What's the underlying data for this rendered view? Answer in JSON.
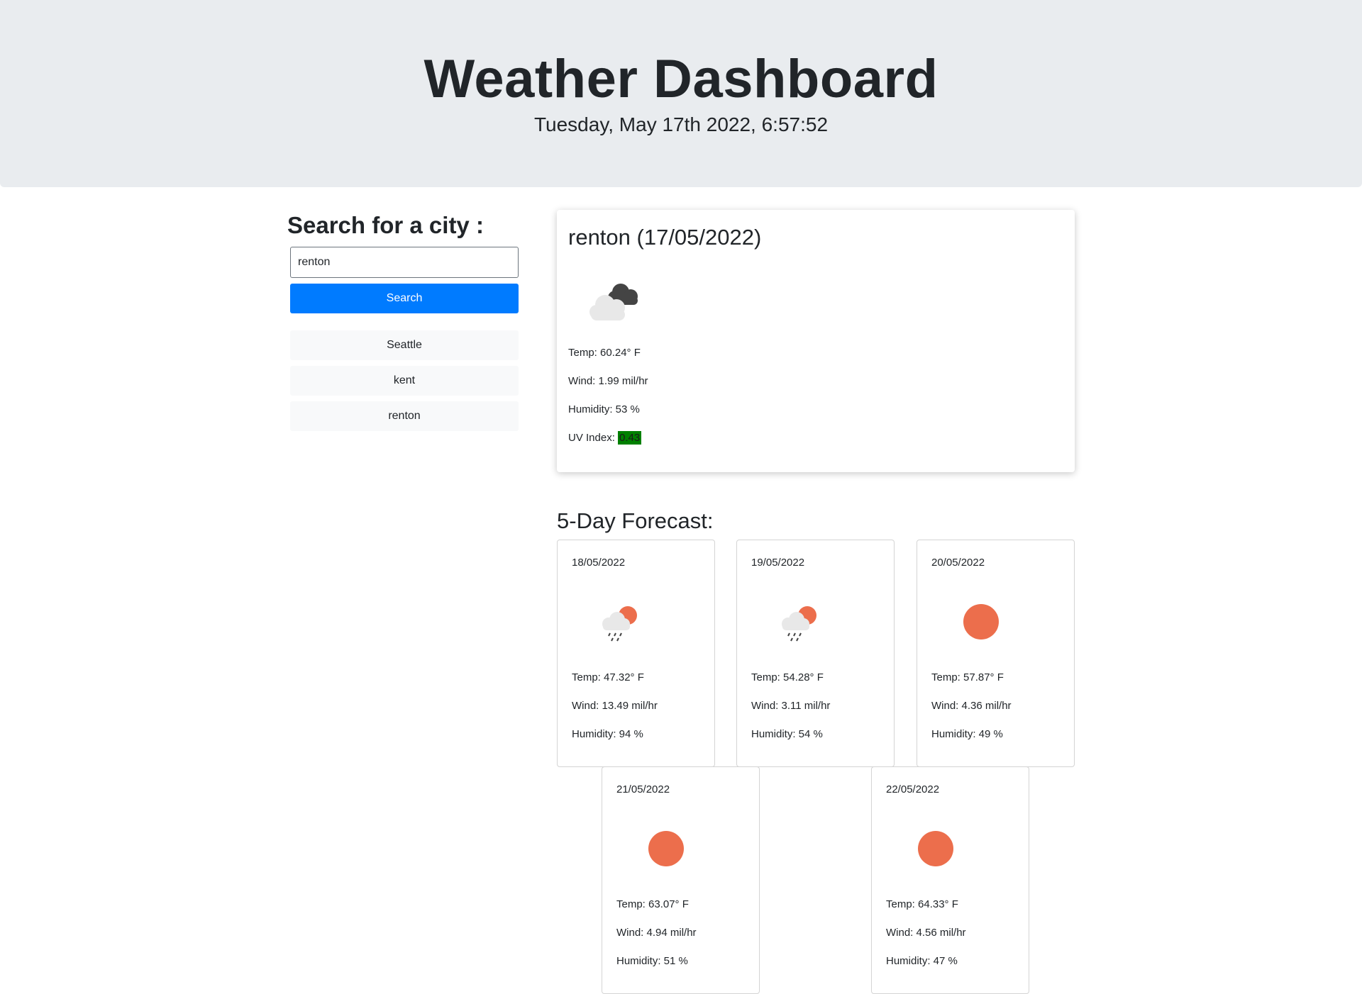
{
  "header": {
    "title": "Weather Dashboard",
    "datetime": "Tuesday, May 17th 2022, 6:57:52"
  },
  "search": {
    "heading": "Search for a city :",
    "value": "renton",
    "button_label": "Search",
    "history": [
      "Seattle",
      "kent",
      "renton"
    ]
  },
  "current": {
    "title": "renton (17/05/2022)",
    "icon": "broken-clouds-icon",
    "temp": "Temp: 60.24° F",
    "wind": "Wind: 1.99 mil/hr",
    "humidity": "Humidity: 53 %",
    "uv_label": "UV Index:",
    "uv_value": "0.43",
    "uv_color": "#008000"
  },
  "forecast": {
    "title": "5-Day Forecast:",
    "days": [
      {
        "date": "18/05/2022",
        "icon": "rain-sun-icon",
        "temp": "Temp: 47.32° F",
        "wind": "Wind: 13.49 mil/hr",
        "humidity": "Humidity: 94 %"
      },
      {
        "date": "19/05/2022",
        "icon": "rain-sun-icon",
        "temp": "Temp: 54.28° F",
        "wind": "Wind: 3.11 mil/hr",
        "humidity": "Humidity: 54 %"
      },
      {
        "date": "20/05/2022",
        "icon": "sun-icon",
        "temp": "Temp: 57.87° F",
        "wind": "Wind: 4.36 mil/hr",
        "humidity": "Humidity: 49 %"
      },
      {
        "date": "21/05/2022",
        "icon": "sun-icon",
        "temp": "Temp: 63.07° F",
        "wind": "Wind: 4.94 mil/hr",
        "humidity": "Humidity: 51 %"
      },
      {
        "date": "22/05/2022",
        "icon": "sun-icon",
        "temp": "Temp: 64.33° F",
        "wind": "Wind: 4.56 mil/hr",
        "humidity": "Humidity: 47 %"
      }
    ]
  },
  "colors": {
    "primary": "#007bff",
    "sun": "#ec6e4c",
    "header_bg": "#e9ecef"
  }
}
